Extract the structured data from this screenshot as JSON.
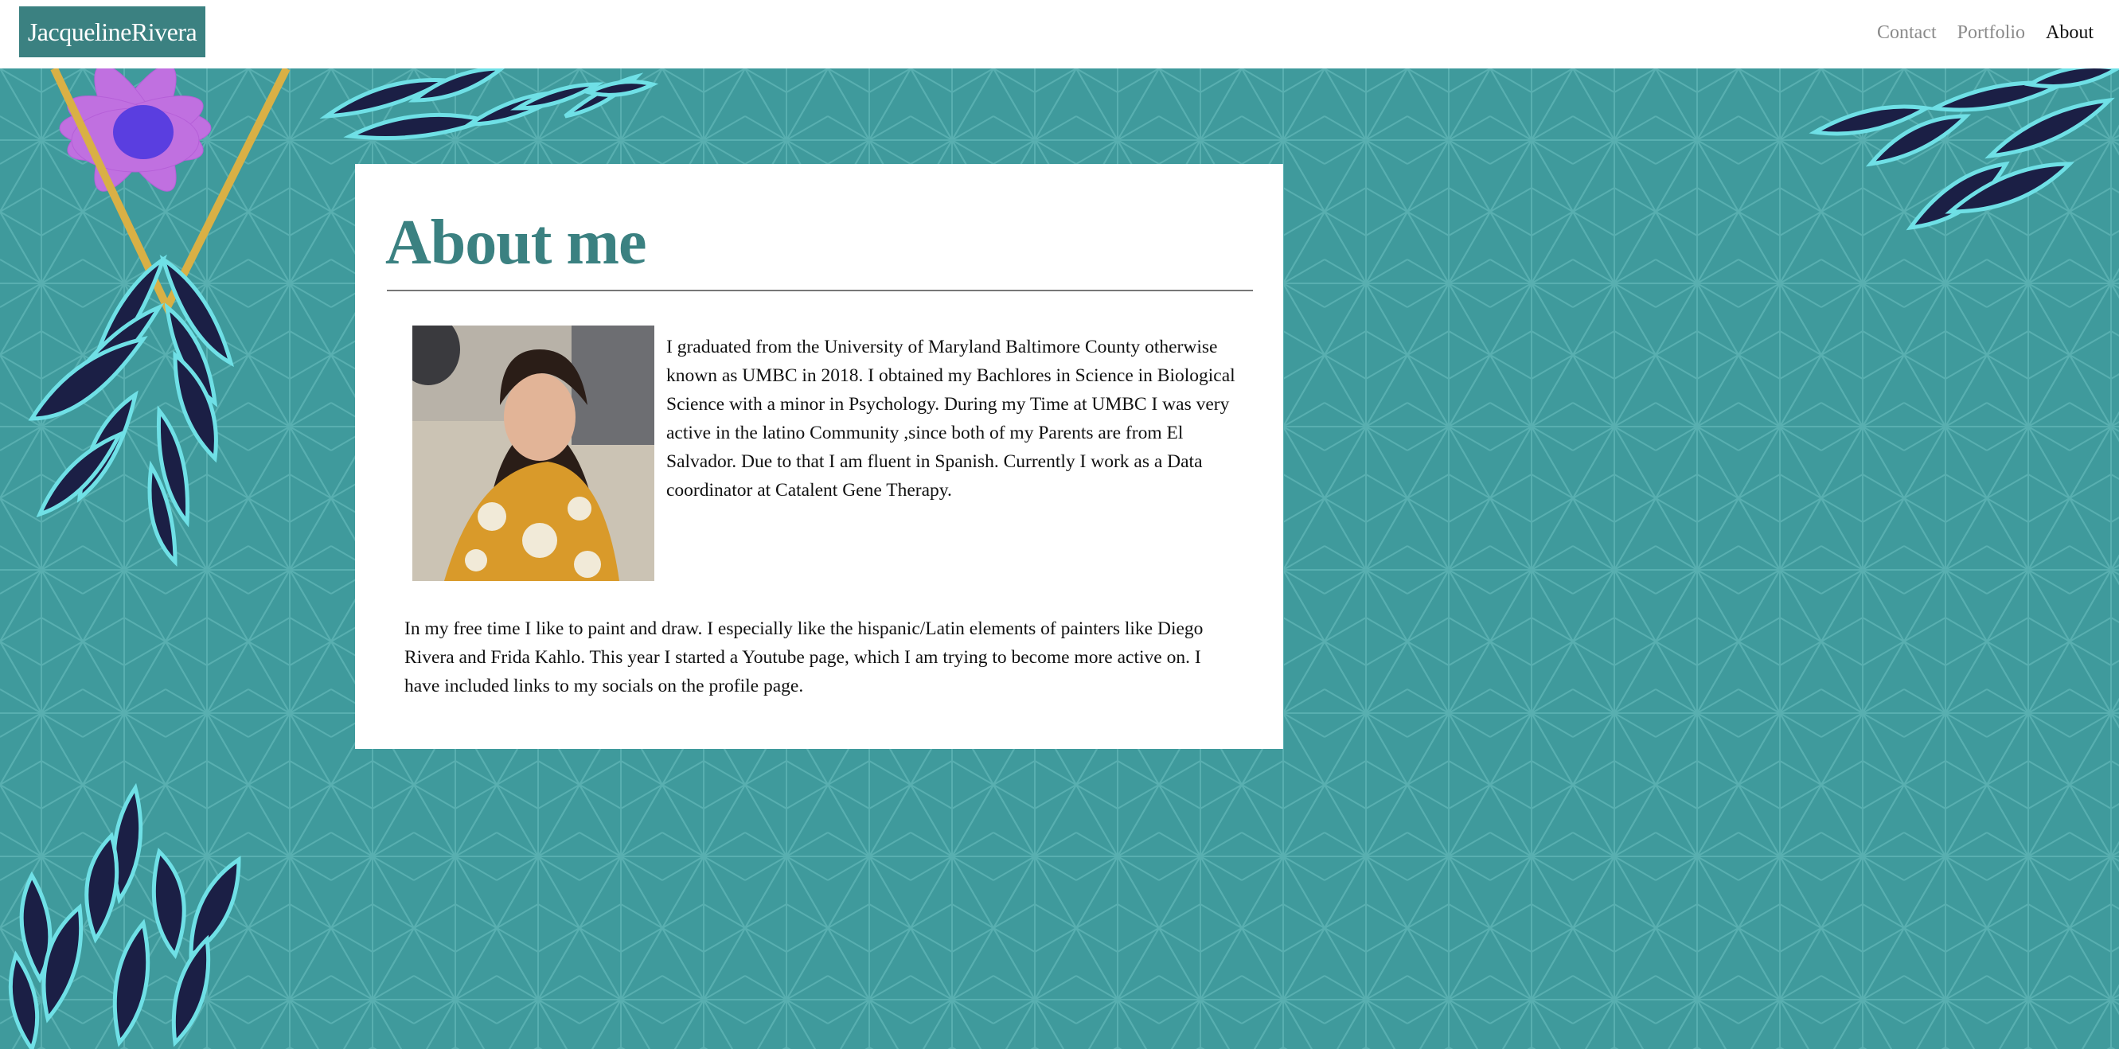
{
  "header": {
    "brand": "JacquelineRivera",
    "nav": [
      {
        "label": "Contact",
        "active": false
      },
      {
        "label": "Portfolio",
        "active": false
      },
      {
        "label": "About",
        "active": true
      }
    ]
  },
  "main": {
    "title": "About me",
    "paragraph1": "I graduated from the University of Maryland Baltimore County otherwise known as UMBC in 2018. I obtained my Bachlores in Science in Biological Science with a minor in Psychology. During my Time at UMBC I was very active in the latino Community ,since both of my Parents are from El Salvador. Due to that I am fluent in Spanish. Currently I work as a Data coordinator at Catalent Gene Therapy.",
    "paragraph2": "In my free time I like to paint and draw. I especially like the hispanic/Latin elements of painters like Diego Rivera and Frida Kahlo. This year I started a Youtube page, which I am trying to become more active on. I have included links to my socials on the profile page."
  },
  "colors": {
    "background": "#3f9a9c",
    "brand_bg": "#3b8181",
    "title": "#3b8181",
    "leaf_dark": "#1b1f45",
    "leaf_light": "#6fe0e6",
    "flower": "#c070e0",
    "gold": "#d9b045"
  }
}
